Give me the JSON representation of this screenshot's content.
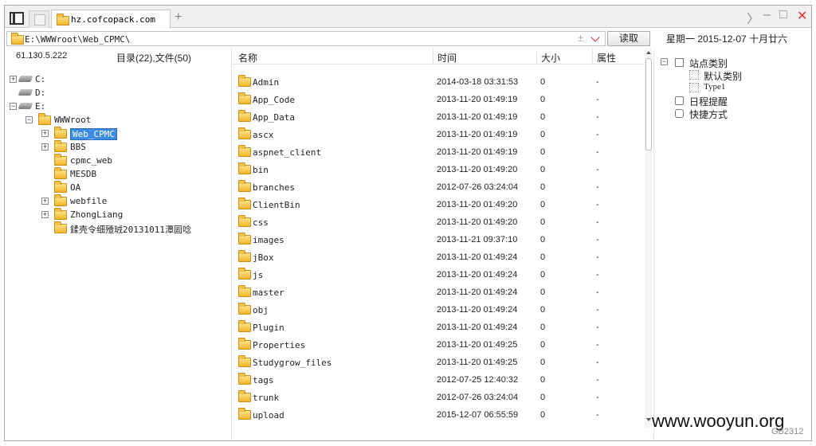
{
  "tab": {
    "title": "hz.cofcopack.com",
    "add_label": "+"
  },
  "window": {
    "forward": "〉",
    "minimize": "–",
    "maximize": "□",
    "close": "✕",
    "close_color": "#e03030"
  },
  "address": {
    "path": "E:\\WWWroot\\Web_CPMC\\",
    "plus": "±",
    "read_button": "读取"
  },
  "date_display": "星期一  2015-12-07  十月廿六",
  "left_panel": {
    "ip": "61.130.5.222",
    "counts": "目录(22),文件(50)",
    "tree": [
      {
        "label": "C:",
        "kind": "drive",
        "expander": "+"
      },
      {
        "label": "D:",
        "kind": "drive",
        "expander": ""
      },
      {
        "label": "E:",
        "kind": "drive",
        "expander": "−"
      },
      {
        "label": "WWWroot",
        "kind": "folder",
        "expander": "−"
      },
      {
        "label": "Web_CPMC",
        "kind": "folder",
        "expander": "+",
        "selected": true
      },
      {
        "label": "BBS",
        "kind": "folder",
        "expander": "+"
      },
      {
        "label": "cpmc_web",
        "kind": "folder",
        "expander": ""
      },
      {
        "label": "MESDB",
        "kind": "folder",
        "expander": ""
      },
      {
        "label": "OA",
        "kind": "folder",
        "expander": ""
      },
      {
        "label": "webfile",
        "kind": "folder",
        "expander": "+"
      },
      {
        "label": "ZhongLiang",
        "kind": "folder",
        "expander": "+"
      },
      {
        "label": "鍒壳令细殪珬20131011潭囩唸",
        "kind": "folder",
        "expander": ""
      }
    ]
  },
  "file_table": {
    "columns": {
      "name": "名称",
      "time": "时间",
      "size": "大小",
      "attr": "属性"
    },
    "rows": [
      {
        "name": "Admin",
        "time": "2014-03-18 03:31:53",
        "size": "0",
        "attr": "-"
      },
      {
        "name": "App_Code",
        "time": "2013-11-20 01:49:19",
        "size": "0",
        "attr": "-"
      },
      {
        "name": "App_Data",
        "time": "2013-11-20 01:49:19",
        "size": "0",
        "attr": "-"
      },
      {
        "name": "ascx",
        "time": "2013-11-20 01:49:19",
        "size": "0",
        "attr": "-"
      },
      {
        "name": "aspnet_client",
        "time": "2013-11-20 01:49:19",
        "size": "0",
        "attr": "-"
      },
      {
        "name": "bin",
        "time": "2013-11-20 01:49:20",
        "size": "0",
        "attr": "-"
      },
      {
        "name": "branches",
        "time": "2012-07-26 03:24:04",
        "size": "0",
        "attr": "-"
      },
      {
        "name": "ClientBin",
        "time": "2013-11-20 01:49:20",
        "size": "0",
        "attr": "-"
      },
      {
        "name": "css",
        "time": "2013-11-20 01:49:20",
        "size": "0",
        "attr": "-"
      },
      {
        "name": "images",
        "time": "2013-11-21 09:37:10",
        "size": "0",
        "attr": "-"
      },
      {
        "name": "jBox",
        "time": "2013-11-20 01:49:24",
        "size": "0",
        "attr": "-"
      },
      {
        "name": "js",
        "time": "2013-11-20 01:49:24",
        "size": "0",
        "attr": "-"
      },
      {
        "name": "master",
        "time": "2013-11-20 01:49:24",
        "size": "0",
        "attr": "-"
      },
      {
        "name": "obj",
        "time": "2013-11-20 01:49:24",
        "size": "0",
        "attr": "-"
      },
      {
        "name": "Plugin",
        "time": "2013-11-20 01:49:24",
        "size": "0",
        "attr": "-"
      },
      {
        "name": "Properties",
        "time": "2013-11-20 01:49:25",
        "size": "0",
        "attr": "-"
      },
      {
        "name": "Studygrow_files",
        "time": "2013-11-20 01:49:25",
        "size": "0",
        "attr": "-"
      },
      {
        "name": "tags",
        "time": "2012-07-25 12:40:32",
        "size": "0",
        "attr": "-"
      },
      {
        "name": "trunk",
        "time": "2012-07-26 03:24:04",
        "size": "0",
        "attr": "-"
      },
      {
        "name": "upload",
        "time": "2015-12-07 06:55:59",
        "size": "0",
        "attr": "-"
      }
    ]
  },
  "right_panel": {
    "site_category": "站点类别",
    "default_category": "默认类别",
    "type1": "Type1",
    "schedule": "日程提醒",
    "shortcut": "快捷方式",
    "collapse": "−"
  },
  "watermark": {
    "site": "www.wooyun.org",
    "encoding": "GB2312"
  }
}
